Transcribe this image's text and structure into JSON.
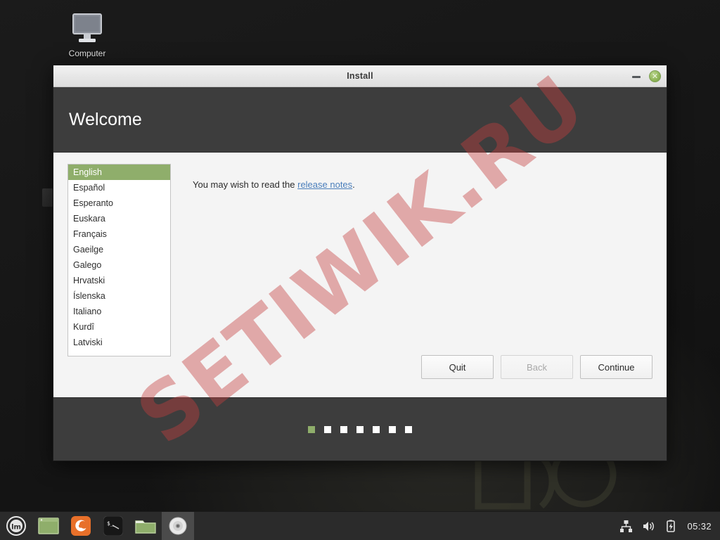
{
  "desktop": {
    "icons": [
      {
        "label": "Computer",
        "icon": "computer-monitor-icon"
      }
    ]
  },
  "watermark": {
    "text": "SETIWIK.RU"
  },
  "window": {
    "title": "Install",
    "page_title": "Welcome",
    "controls": {
      "minimize": "minimize-icon",
      "close": "close-icon",
      "close_glyph": "✕"
    },
    "languages": [
      "English",
      "Español",
      "Esperanto",
      "Euskara",
      "Français",
      "Gaeilge",
      "Galego",
      "Hrvatski",
      "Íslenska",
      "Italiano",
      "Kurdî",
      "Latviski"
    ],
    "selected_language": "English",
    "intro": {
      "prefix": "You may wish to read the ",
      "link": "release notes",
      "suffix": "."
    },
    "buttons": {
      "quit": "Quit",
      "back": "Back",
      "continue": "Continue"
    },
    "back_disabled": true,
    "progress_dots": {
      "total": 7,
      "active_index": 0
    }
  },
  "taskbar": {
    "launchers": [
      {
        "name": "mint-menu-icon",
        "label": "Menu"
      },
      {
        "name": "window-list-icon",
        "label": "Window"
      },
      {
        "name": "firefox-icon",
        "label": "Firefox"
      },
      {
        "name": "terminal-icon",
        "label": "Terminal"
      },
      {
        "name": "file-manager-icon",
        "label": "Files"
      },
      {
        "name": "disc-installer-icon",
        "label": "Install",
        "active": true
      }
    ],
    "tray": [
      {
        "name": "network-icon"
      },
      {
        "name": "volume-icon"
      },
      {
        "name": "battery-charging-icon"
      }
    ],
    "clock": "05:32"
  },
  "colors": {
    "accent_green": "#8fae6b",
    "header_dark": "#3d3d3d",
    "body_light": "#f4f4f4",
    "link_blue": "#4a7ebb",
    "watermark_red": "#c43e3e"
  }
}
